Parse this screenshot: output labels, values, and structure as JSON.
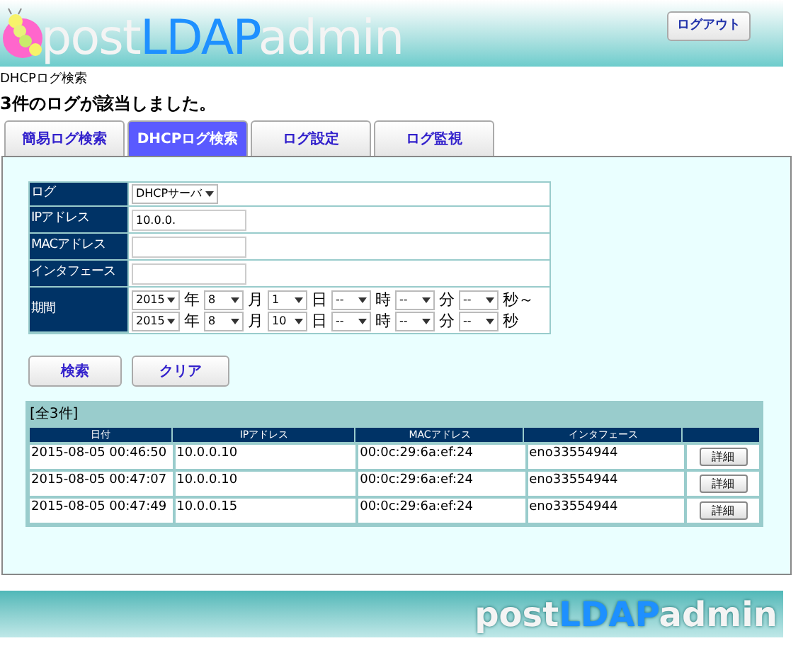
{
  "header": {
    "logo_parts": [
      "post",
      "LDAP",
      "admin"
    ],
    "logout_button": "ログアウト"
  },
  "breadcrumb": "DHCPログ検索",
  "result_message": "3件のログが該当しました。",
  "tabs": [
    {
      "label": "簡易ログ検索",
      "selected": false
    },
    {
      "label": "DHCPログ検索",
      "selected": true
    },
    {
      "label": "ログ設定",
      "selected": false
    },
    {
      "label": "ログ監視",
      "selected": false
    }
  ],
  "form": {
    "rows": [
      {
        "kind": "select",
        "label": "ログ",
        "value": "DHCPサーバ"
      },
      {
        "kind": "text",
        "label": "IPアドレス",
        "value": "10.0.0."
      },
      {
        "kind": "text",
        "label": "MACアドレス"
      },
      {
        "kind": "text",
        "label": "インタフェース"
      },
      {
        "kind": "period",
        "label": "期間",
        "lines": [
          [
            {
              "value": "2015",
              "unit": "年"
            },
            {
              "value": "8",
              "unit": "月"
            },
            {
              "value": "1",
              "unit": "日"
            },
            {
              "value": "--",
              "unit": "時"
            },
            {
              "value": "--",
              "unit": "分"
            },
            {
              "value": "--",
              "unit": "秒～"
            }
          ],
          [
            {
              "value": "2015",
              "unit": "年"
            },
            {
              "value": "8",
              "unit": "月"
            },
            {
              "value": "10",
              "unit": "日"
            },
            {
              "value": "--",
              "unit": "時"
            },
            {
              "value": "--",
              "unit": "分"
            },
            {
              "value": "--",
              "unit": "秒"
            }
          ]
        ]
      }
    ]
  },
  "buttons": [
    "検索",
    "クリア"
  ],
  "results": {
    "count_label": "[全3件]",
    "columns": [
      "日付",
      "IPアドレス",
      "MACアドレス",
      "インタフェース"
    ],
    "rows": [
      {
        "cells": [
          "2015-08-05 00:46:50",
          "10.0.0.10",
          "00:0c:29:6a:ef:24",
          "eno33554944"
        ],
        "action": "詳細"
      },
      {
        "cells": [
          "2015-08-05 00:47:07",
          "10.0.0.10",
          "00:0c:29:6a:ef:24",
          "eno33554944"
        ],
        "action": "詳細"
      },
      {
        "cells": [
          "2015-08-05 00:47:49",
          "10.0.0.15",
          "00:0c:29:6a:ef:24",
          "eno33554944"
        ],
        "action": "詳細"
      }
    ]
  },
  "footer": {
    "logo_parts": [
      "post",
      "LDAP",
      "admin"
    ]
  }
}
